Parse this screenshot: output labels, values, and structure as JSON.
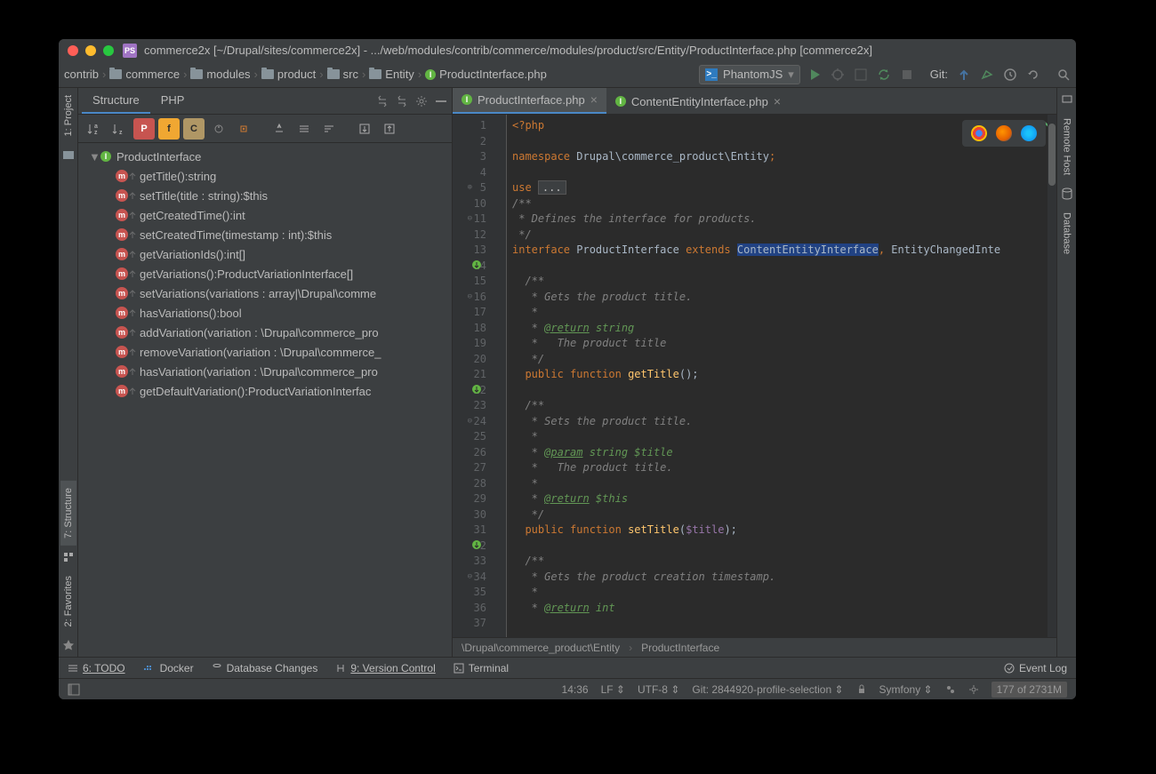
{
  "title": "commerce2x [~/Drupal/sites/commerce2x] - .../web/modules/contrib/commerce/modules/product/src/Entity/ProductInterface.php [commerce2x]",
  "breadcrumb": [
    "contrib",
    "commerce",
    "modules",
    "product",
    "src",
    "Entity",
    "ProductInterface.php"
  ],
  "runConfig": "PhantomJS",
  "gitLabel": "Git:",
  "panel": {
    "tabs": [
      "Structure",
      "PHP"
    ],
    "root": "ProductInterface",
    "methods": [
      "getTitle():string",
      "setTitle(title : string):$this",
      "getCreatedTime():int",
      "setCreatedTime(timestamp : int):$this",
      "getVariationIds():int[]",
      "getVariations():ProductVariationInterface[]",
      "setVariations(variations : array|\\Drupal\\comme",
      "hasVariations():bool",
      "addVariation(variation : \\Drupal\\commerce_pro",
      "removeVariation(variation : \\Drupal\\commerce_",
      "hasVariation(variation : \\Drupal\\commerce_pro",
      "getDefaultVariation():ProductVariationInterfac"
    ]
  },
  "tabs": [
    "ProductInterface.php",
    "ContentEntityInterface.php"
  ],
  "code": {
    "lines": [
      "1",
      "2",
      "3",
      "4",
      "5",
      "10",
      "11",
      "12",
      "13",
      "14",
      "15",
      "16",
      "17",
      "18",
      "19",
      "20",
      "21",
      "22",
      "23",
      "24",
      "25",
      "26",
      "27",
      "28",
      "29",
      "30",
      "31",
      "32",
      "33",
      "34",
      "35",
      "36",
      "37"
    ],
    "l1a": "<?php",
    "l3a": "namespace",
    "l3b": " Drupal\\commerce_product\\Entity",
    "l3c": ";",
    "l5a": "use ",
    "l5b": "...",
    "l11": "/**",
    "l12": " * Defines the interface for products.",
    "l13": " */",
    "l14a": "interface",
    "l14b": " ProductInterface ",
    "l14c": "extends",
    "l14d": " ",
    "l14e": "ContentEntityInterface",
    "l14f": ", ",
    "l14g": "EntityChangedInte",
    "l16": "  /**",
    "l17": "   * Gets the product title.",
    "l18": "   *",
    "l19a": "   * ",
    "l19b": "@return",
    "l19c": " string",
    "l20": "   *   The product title",
    "l21": "   */",
    "l22a": "  public",
    "l22b": " function",
    "l22c": " ",
    "l22d": "getTitle",
    "l22e": "();",
    "l24": "  /**",
    "l25": "   * Sets the product title.",
    "l26": "   *",
    "l27a": "   * ",
    "l27b": "@param",
    "l27c": " string $title",
    "l28": "   *   The product title.",
    "l29": "   *",
    "l30a": "   * ",
    "l30b": "@return",
    "l30c": " $this",
    "l31": "   */",
    "l32a": "  public",
    "l32b": " function",
    "l32c": " ",
    "l32d": "setTitle",
    "l32e": "(",
    "l32f": "$title",
    "l32g": ");",
    "l34": "  /**",
    "l35": "   * Gets the product creation timestamp.",
    "l36": "   *",
    "l37a": "   * ",
    "l37b": "@return",
    "l37c": " int"
  },
  "editorCrumb": {
    "a": "\\Drupal\\commerce_product\\Entity",
    "sep": "›",
    "b": "ProductInterface"
  },
  "toolwindows": [
    "6: TODO",
    "Docker",
    "Database Changes",
    "9: Version Control",
    "Terminal"
  ],
  "eventLog": "Event Log",
  "status": {
    "pos": "14:36",
    "lf": "LF",
    "enc": "UTF-8",
    "branch": "Git: 2844920-profile-selection",
    "fw": "Symfony",
    "mem": "177 of 2731M"
  },
  "leftTools": [
    "1: Project",
    "7: Structure",
    "2: Favorites"
  ],
  "rightTools": [
    "Remote Host",
    "Database"
  ]
}
